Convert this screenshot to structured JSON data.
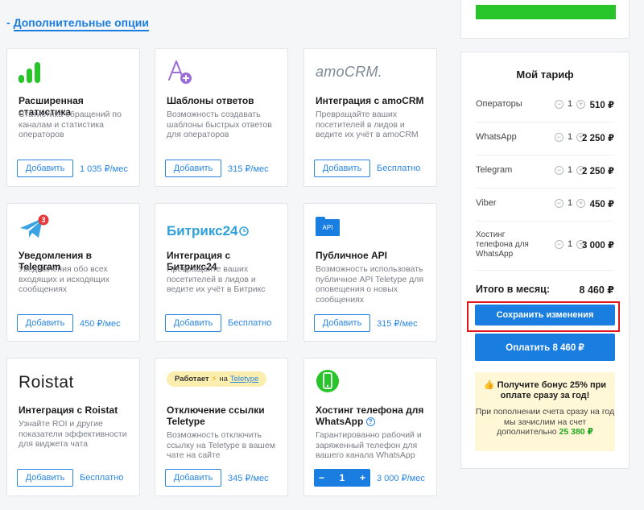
{
  "section": {
    "prefix": "- ",
    "title": "Дополнительные опции"
  },
  "cards": [
    {
      "icon": "bar-chart-icon",
      "title": "Расширенная статистика",
      "desc": "Статистика обращений по каналам и статистика операторов",
      "button": "Добавить",
      "price": "1 035 ₽/мес"
    },
    {
      "icon": "templates-icon",
      "title": "Шаблоны ответов",
      "desc": "Возможность создавать шаблоны быстрых ответов для операторов",
      "button": "Добавить",
      "price": "315 ₽/мес"
    },
    {
      "icon": "amocrm-logo",
      "logo_text": "amoCRM.",
      "title": "Интеграция с amoCRM",
      "desc": "Превращайте ваших посетителей в лидов и ведите их учёт в amoCRM",
      "button": "Добавить",
      "price": "Бесплатно"
    },
    {
      "icon": "telegram-icon",
      "badge": "3",
      "title": "Уведомления в Telegram",
      "desc": "Уведомления обо всех входящих и исходящих сообщениях",
      "button": "Добавить",
      "price": "450 ₽/мес"
    },
    {
      "icon": "bitrix24-logo",
      "logo_text": "Битрикс24",
      "title": "Интеграция с Битрикс24",
      "desc": "Превращайте ваших посетителей в лидов и ведите их учёт в Битрикс",
      "button": "Добавить",
      "price": "Бесплатно"
    },
    {
      "icon": "api-folder-icon",
      "logo_text": "API",
      "title": "Публичное API",
      "desc": "Возможность использовать публичное API Teletype для оповещения о новых сообщениях",
      "button": "Добавить",
      "price": "315 ₽/мес"
    },
    {
      "icon": "roistat-logo",
      "logo_text": "Roistat",
      "title": "Интеграция с Roistat",
      "desc": "Узнайте ROI и другие показатели эффективности для виджета чата",
      "button": "Добавить",
      "price": "Бесплатно"
    },
    {
      "icon": "teletype-badge",
      "logo_text": "Работает",
      "logo_text2": "на",
      "logo_link": "Teletype",
      "title": "Отключение ссылки Teletype",
      "desc": "Возможность отключить ссылку на Teletype в вашем чате на сайте",
      "button": "Добавить",
      "price": "345 ₽/мес"
    },
    {
      "icon": "phone-icon",
      "title": "Хостинг телефона для WhatsApp",
      "desc": "Гарантированно рабочий и заряженный телефон для вашего канала WhatsApp",
      "stepper": {
        "minus": "−",
        "value": "1",
        "plus": "+"
      },
      "price": "3 000 ₽/мес"
    }
  ],
  "tariff": {
    "heading": "Мой тариф",
    "rows": [
      {
        "label": "Операторы",
        "qty": "1",
        "value": "510 ₽"
      },
      {
        "label": "WhatsApp",
        "qty": "1",
        "value": "2 250 ₽"
      },
      {
        "label": "Telegram",
        "qty": "1",
        "value": "2 250 ₽"
      },
      {
        "label": "Viber",
        "qty": "1",
        "value": "450 ₽"
      },
      {
        "label": "Хостинг телефона для WhatsApp",
        "qty": "1",
        "value": "3 000 ₽"
      }
    ],
    "total_label": "Итого в месяц:",
    "total_value": "8 460 ₽",
    "save_button": "Сохранить изменения",
    "pay_button": "Оплатить 8 460 ₽",
    "bonus_title": "Получите бонус 25% при оплате сразу за год!",
    "bonus_text": "При пополнении счета сразу на год мы зачислим на счет дополнительно",
    "bonus_amount": "25 380 ₽"
  },
  "colors": {
    "accent": "#1a7ee0",
    "green": "#27c52a",
    "highlight": "#e0161d"
  }
}
